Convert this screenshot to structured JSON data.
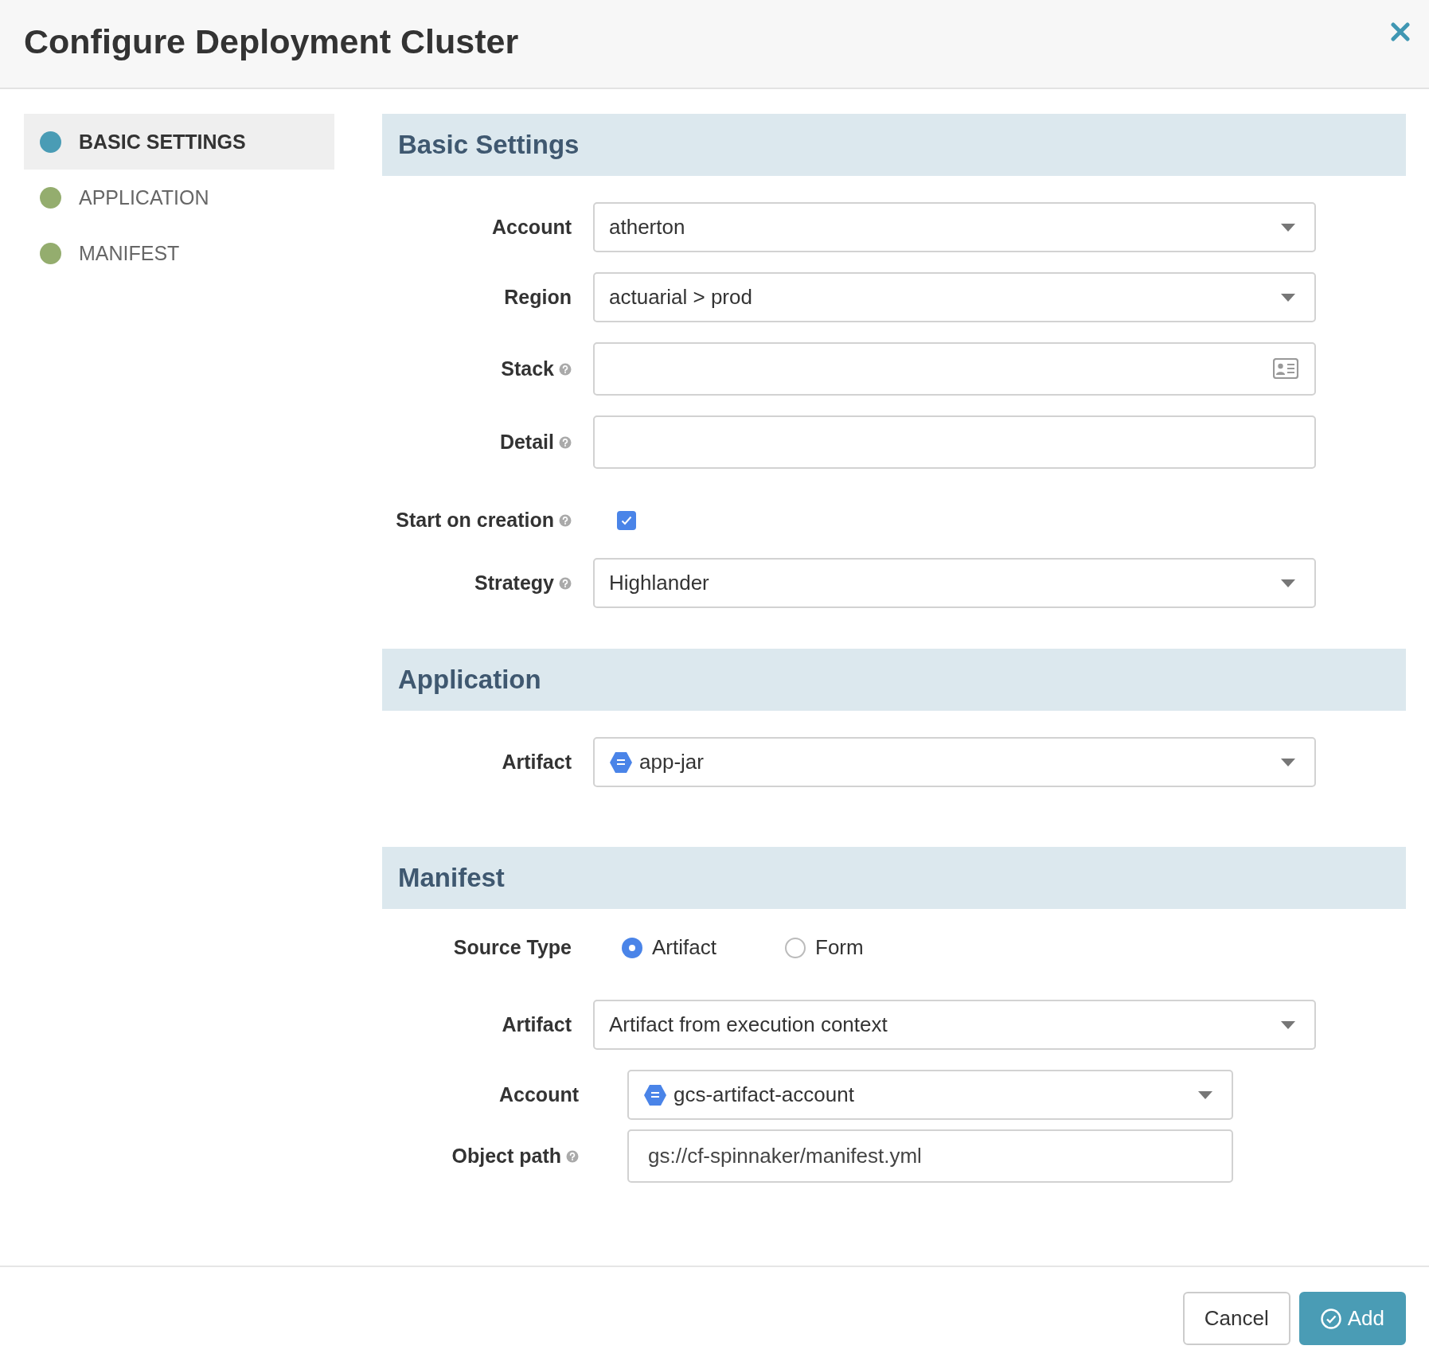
{
  "dialog": {
    "title": "Configure Deployment Cluster"
  },
  "sidebar": {
    "items": [
      {
        "label": "BASIC SETTINGS",
        "selected": true,
        "color": "#4a9cb5"
      },
      {
        "label": "APPLICATION",
        "selected": false,
        "color": "#94ad6e"
      },
      {
        "label": "MANIFEST",
        "selected": false,
        "color": "#94ad6e"
      }
    ]
  },
  "sections": [
    {
      "title": "Basic Settings",
      "rows": [
        {
          "kind": "select",
          "label": "Account",
          "help": false,
          "value": "atherton"
        },
        {
          "kind": "select",
          "label": "Region",
          "help": false,
          "value": "actuarial > prod"
        },
        {
          "kind": "text",
          "label": "Stack",
          "help": true,
          "card_icon": true
        },
        {
          "kind": "text",
          "label": "Detail",
          "help": true
        },
        {
          "kind": "checkbox",
          "label": "Start on creation",
          "help": true,
          "checked": true
        },
        {
          "kind": "select",
          "label": "Strategy",
          "help": true,
          "value": "Highlander"
        }
      ]
    },
    {
      "title": "Application",
      "rows": [
        {
          "kind": "select",
          "label": "Artifact",
          "help": false,
          "value": "app-jar",
          "artifact_icon": true
        }
      ]
    },
    {
      "title": "Manifest",
      "rows": [
        {
          "kind": "radio",
          "label": "Source Type",
          "help": false,
          "options": [
            {
              "label": "Artifact",
              "selected": true
            },
            {
              "label": "Form",
              "selected": false
            }
          ]
        },
        {
          "kind": "select",
          "label": "Artifact",
          "help": false,
          "value": "Artifact from execution context"
        },
        {
          "kind": "select",
          "label": "Account",
          "help": false,
          "value": "gcs-artifact-account",
          "artifact_icon": true,
          "indented": true
        },
        {
          "kind": "text",
          "label": "Object path",
          "help": true,
          "value": "gs://cf-spinnaker/manifest.yml",
          "indented": true
        }
      ]
    }
  ],
  "footer": {
    "buttons": [
      {
        "label": "Cancel",
        "kind": "secondary"
      },
      {
        "label": "Add",
        "kind": "primary"
      }
    ]
  }
}
